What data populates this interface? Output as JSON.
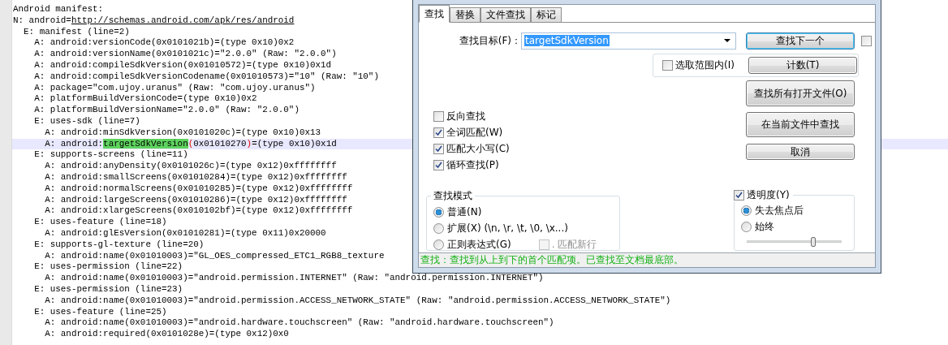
{
  "editor": {
    "lines": [
      {
        "current": false,
        "segments": [
          {
            "kind": "plain",
            "text": "Android manifest:"
          }
        ]
      },
      {
        "current": false,
        "segments": [
          {
            "kind": "plain",
            "text": "N: android="
          },
          {
            "kind": "link",
            "text": "http://schemas.android.com/apk/res/android"
          }
        ]
      },
      {
        "current": false,
        "segments": [
          {
            "kind": "plain",
            "text": "  E: manifest (line=2)"
          }
        ]
      },
      {
        "current": false,
        "segments": [
          {
            "kind": "plain",
            "text": "    A: android:versionCode(0x0101021b)=(type 0x10)0x2"
          }
        ]
      },
      {
        "current": false,
        "segments": [
          {
            "kind": "plain",
            "text": "    A: android:versionName(0x0101021c)=\"2.0.0\" (Raw: \"2.0.0\")"
          }
        ]
      },
      {
        "current": false,
        "segments": [
          {
            "kind": "plain",
            "text": "    A: android:compileSdkVersion(0x01010572)=(type 0x10)0x1d"
          }
        ]
      },
      {
        "current": false,
        "segments": [
          {
            "kind": "plain",
            "text": "    A: android:compileSdkVersionCodename(0x01010573)=\"10\" (Raw: \"10\")"
          }
        ]
      },
      {
        "current": false,
        "segments": [
          {
            "kind": "plain",
            "text": "    A: package=\"com.ujoy.uranus\" (Raw: \"com.ujoy.uranus\")"
          }
        ]
      },
      {
        "current": false,
        "segments": [
          {
            "kind": "plain",
            "text": "    A: platformBuildVersionCode=(type 0x10)0x2"
          }
        ]
      },
      {
        "current": false,
        "segments": [
          {
            "kind": "plain",
            "text": "    A: platformBuildVersionName=\"2.0.0\" (Raw: \"2.0.0\")"
          }
        ]
      },
      {
        "current": false,
        "segments": [
          {
            "kind": "plain",
            "text": "    E: uses-sdk (line=7)"
          }
        ]
      },
      {
        "current": false,
        "segments": [
          {
            "kind": "plain",
            "text": "      A: android:minSdkVersion(0x0101020c)=(type 0x10)0x13"
          }
        ]
      },
      {
        "current": true,
        "segments": [
          {
            "kind": "plain",
            "text": "      A: android:"
          },
          {
            "kind": "match",
            "text": "targetSdkVersion"
          },
          {
            "kind": "brace",
            "text": "("
          },
          {
            "kind": "plain",
            "text": "0x01010270"
          },
          {
            "kind": "brace",
            "text": ")"
          },
          {
            "kind": "plain",
            "text": "=(type 0x10)0x1d"
          }
        ]
      },
      {
        "current": false,
        "segments": [
          {
            "kind": "plain",
            "text": "    E: supports-screens (line=11)"
          }
        ]
      },
      {
        "current": false,
        "segments": [
          {
            "kind": "plain",
            "text": "      A: android:anyDensity(0x0101026c)=(type 0x12)0xffffffff"
          }
        ]
      },
      {
        "current": false,
        "segments": [
          {
            "kind": "plain",
            "text": "      A: android:smallScreens(0x01010284)=(type 0x12)0xffffffff"
          }
        ]
      },
      {
        "current": false,
        "segments": [
          {
            "kind": "plain",
            "text": "      A: android:normalScreens(0x01010285)=(type 0x12)0xffffffff"
          }
        ]
      },
      {
        "current": false,
        "segments": [
          {
            "kind": "plain",
            "text": "      A: android:largeScreens(0x01010286)=(type 0x12)0xffffffff"
          }
        ]
      },
      {
        "current": false,
        "segments": [
          {
            "kind": "plain",
            "text": "      A: android:xlargeScreens(0x010102bf)=(type 0x12)0xffffffff"
          }
        ]
      },
      {
        "current": false,
        "segments": [
          {
            "kind": "plain",
            "text": "    E: uses-feature (line=18)"
          }
        ]
      },
      {
        "current": false,
        "segments": [
          {
            "kind": "plain",
            "text": "      A: android:glEsVersion(0x01010281)=(type 0x11)0x20000"
          }
        ]
      },
      {
        "current": false,
        "segments": [
          {
            "kind": "plain",
            "text": "    E: supports-gl-texture (line=20)"
          }
        ]
      },
      {
        "current": false,
        "segments": [
          {
            "kind": "plain",
            "text": "      A: android:name(0x01010003)=\"GL_OES_compressed_ETC1_RGB8_texture"
          }
        ]
      },
      {
        "current": false,
        "segments": [
          {
            "kind": "plain",
            "text": "    E: uses-permission (line=22)"
          }
        ]
      },
      {
        "current": false,
        "segments": [
          {
            "kind": "plain",
            "text": "      A: android:name(0x01010003)=\"android.permission.INTERNET\" (Raw: \"android.permission.INTERNET\")"
          }
        ]
      },
      {
        "current": false,
        "segments": [
          {
            "kind": "plain",
            "text": "    E: uses-permission (line=23)"
          }
        ]
      },
      {
        "current": false,
        "segments": [
          {
            "kind": "plain",
            "text": "      A: android:name(0x01010003)=\"android.permission.ACCESS_NETWORK_STATE\" (Raw: \"android.permission.ACCESS_NETWORK_STATE\")"
          }
        ]
      },
      {
        "current": false,
        "segments": [
          {
            "kind": "plain",
            "text": "    E: uses-feature (line=25)"
          }
        ]
      },
      {
        "current": false,
        "segments": [
          {
            "kind": "plain",
            "text": "      A: android:name(0x01010003)=\"android.hardware.touchscreen\" (Raw: \"android.hardware.touchscreen\")"
          }
        ]
      },
      {
        "current": false,
        "segments": [
          {
            "kind": "plain",
            "text": "      A: android:required(0x0101028e)=(type 0x12)0x0"
          }
        ]
      }
    ]
  },
  "find_dialog": {
    "tabs": [
      {
        "label": "查找",
        "selected": true
      },
      {
        "label": "替换",
        "selected": false
      },
      {
        "label": "文件查找",
        "selected": false
      },
      {
        "label": "标记",
        "selected": false
      }
    ],
    "find_label": "查找目标(F)：",
    "find_value": "targetSdkVersion",
    "find_next_button": "查找下一个",
    "side_checkbox": {
      "checked": false
    },
    "in_selection": {
      "label": "选取范围内(I)",
      "checked": false
    },
    "count_button": "计数(T)",
    "find_all_open_button": "查找所有打开文件(O)",
    "find_in_current_button": "在当前文件中查找",
    "cancel_button": "取消",
    "options": [
      {
        "label": "反向查找",
        "checked": false
      },
      {
        "label": "全词匹配(W)",
        "checked": true
      },
      {
        "label": "匹配大小写(C)",
        "checked": true
      },
      {
        "label": "循环查找(P)",
        "checked": true
      }
    ],
    "search_mode": {
      "title": "查找模式",
      "modes": [
        {
          "label": "普通(N)",
          "selected": true
        },
        {
          "label": "扩展(X) (\\n, \\r, \\t, \\0, \\x...)",
          "selected": false
        },
        {
          "label": "正则表达式(G)",
          "selected": false
        }
      ],
      "dot_newline": {
        "label": ". 匹配新行",
        "checked": false,
        "disabled": true
      }
    },
    "transparency": {
      "label": "透明度(Y)",
      "checked": true,
      "modes": [
        {
          "label": "失去焦点后",
          "selected": true
        },
        {
          "label": "始终",
          "selected": false
        }
      ],
      "level": 0.7
    },
    "status": "查找：查找到从上到下的首个匹配项。已查找至文档最底部。"
  }
}
